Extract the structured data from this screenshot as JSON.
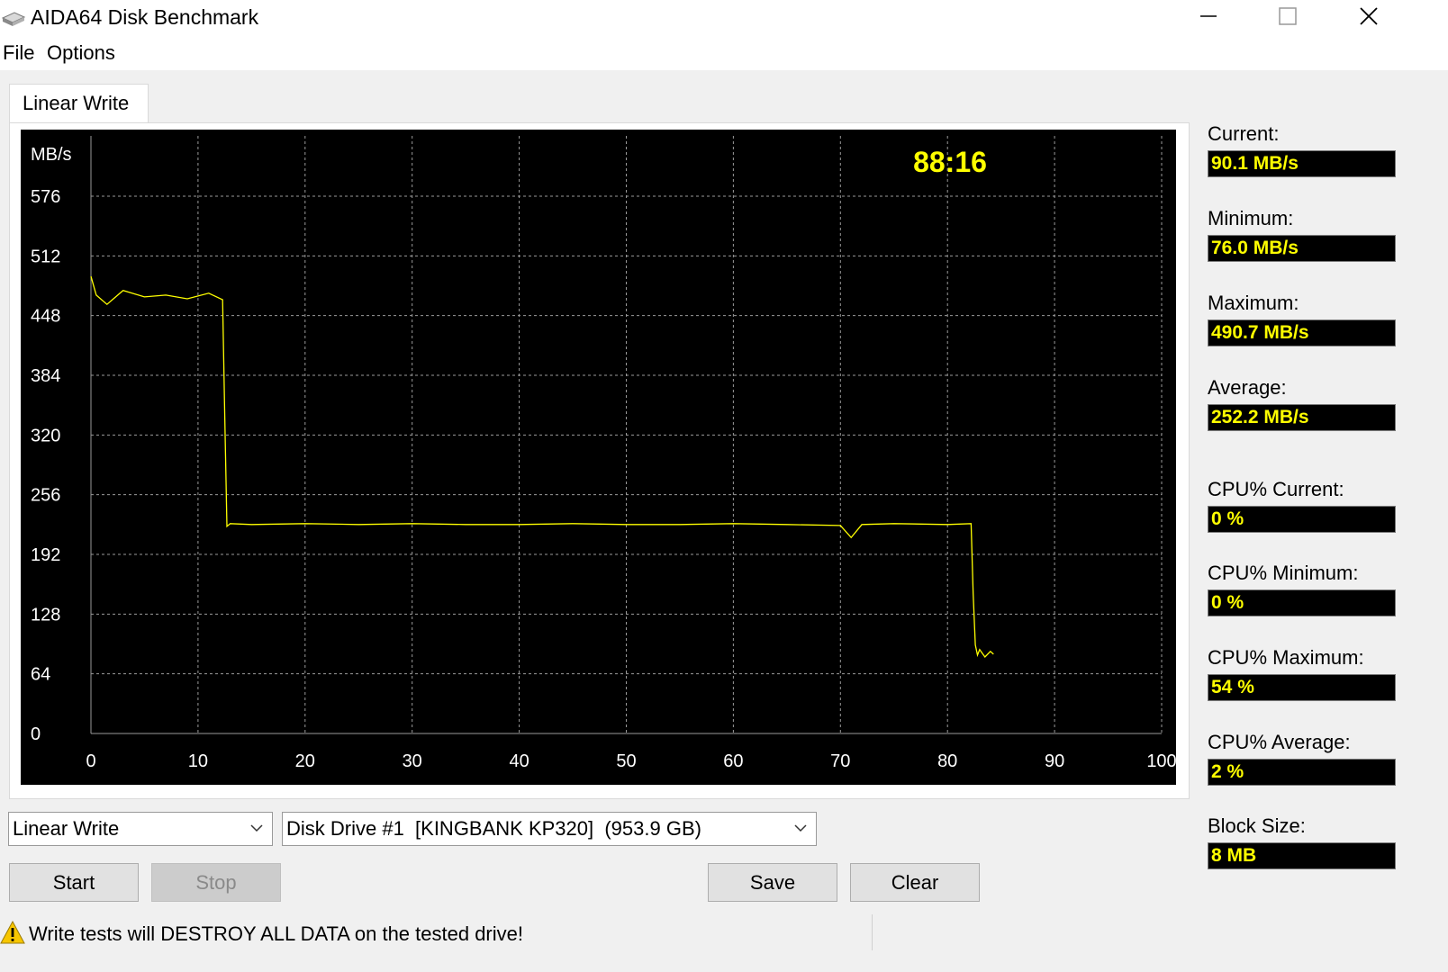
{
  "window": {
    "title": "AIDA64 Disk Benchmark"
  },
  "menu": {
    "file": "File",
    "options": "Options"
  },
  "tab": {
    "label": "Linear Write"
  },
  "chart_timer": "88:16",
  "stats": [
    {
      "label": "Current:",
      "value": "90.1 MB/s"
    },
    {
      "label": "Minimum:",
      "value": "76.0 MB/s"
    },
    {
      "label": "Maximum:",
      "value": "490.7 MB/s"
    },
    {
      "label": "Average:",
      "value": "252.2 MB/s"
    },
    {
      "label": "CPU% Current:",
      "value": "0 %"
    },
    {
      "label": "CPU% Minimum:",
      "value": "0 %"
    },
    {
      "label": "CPU% Maximum:",
      "value": "54 %"
    },
    {
      "label": "CPU% Average:",
      "value": "2 %"
    },
    {
      "label": "Block Size:",
      "value": "8 MB"
    }
  ],
  "controls": {
    "test_select": "Linear Write",
    "drive_select": "Disk Drive #1  [KINGBANK KP320]  (953.9 GB)",
    "start": "Start",
    "stop": "Stop",
    "save": "Save",
    "clear": "Clear"
  },
  "status": {
    "warning": "Write tests will DESTROY ALL DATA on the tested drive!"
  },
  "colors": {
    "trace": "#ffff00",
    "value_text": "#ffff00",
    "grid": "#9a9a9a"
  },
  "chart_data": {
    "type": "line",
    "ylabel": "MB/s",
    "xlabel": "%",
    "xlim": [
      0,
      100
    ],
    "ylim": [
      0,
      576
    ],
    "x_ticks": [
      0,
      10,
      20,
      30,
      40,
      50,
      60,
      70,
      80,
      90,
      100
    ],
    "y_ticks": [
      0,
      64,
      128,
      192,
      256,
      320,
      384,
      448,
      512,
      576
    ],
    "grid": true,
    "series": [
      {
        "x": [
          0,
          0.5,
          1.5,
          3,
          5,
          7,
          9,
          11,
          12.3,
          12.5,
          12.7,
          13,
          15,
          20,
          25,
          30,
          35,
          40,
          45,
          50,
          55,
          60,
          65,
          70,
          71,
          72,
          75,
          80,
          82.2,
          82.4,
          82.6,
          82.8,
          83,
          83.5,
          84,
          84.3
        ],
        "y": [
          490,
          470,
          460,
          475,
          468,
          470,
          466,
          472,
          465,
          340,
          222,
          225,
          224,
          225,
          224,
          225,
          224,
          224,
          225,
          224,
          224,
          225,
          224,
          223,
          210,
          224,
          225,
          224,
          225,
          150,
          95,
          84,
          90,
          82,
          88,
          85
        ]
      }
    ]
  }
}
